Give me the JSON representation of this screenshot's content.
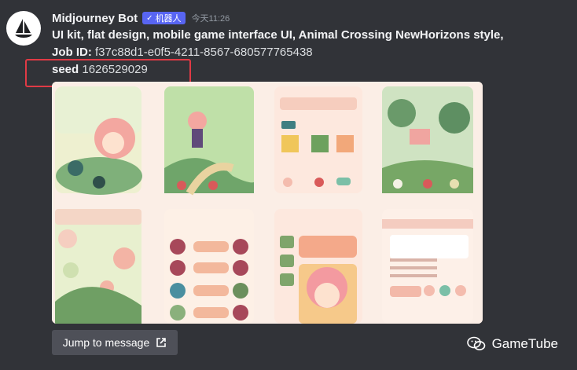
{
  "message": {
    "author": "Midjourney Bot",
    "bot_tag": {
      "check": "✓",
      "label": "机器人"
    },
    "timestamp": "今天11:26",
    "prompt": "UI kit, flat design, mobile game interface UI, Animal Crossing NewHorizons style,",
    "job_id_label": "Job ID:",
    "job_id": "f37c88d1-e0f5-4211-8567-680577765438",
    "seed_label": "seed",
    "seed": "1626529029"
  },
  "image": {
    "description_icon": "generated-image-grid"
  },
  "jump_button": {
    "label": "Jump to message",
    "icon": "external-link-icon"
  },
  "watermark": {
    "label": "GameTube",
    "icon": "wechat-icon"
  },
  "colors": {
    "background": "#313338",
    "bot_tag": "#5865f2",
    "highlight": "#e03a45",
    "button": "#4e5058"
  }
}
